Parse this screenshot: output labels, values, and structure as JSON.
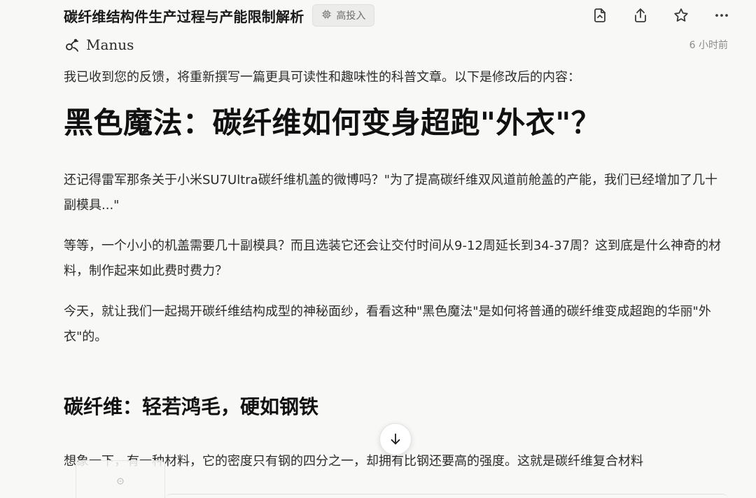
{
  "header": {
    "title": "碳纤维结构件生产过程与产能限制解析",
    "badge_label": "高投入",
    "badge_icon": "chip-icon",
    "toolbar_icons": [
      "file-export-icon",
      "share-icon",
      "star-icon",
      "more-icon"
    ]
  },
  "author": {
    "name": "Manus",
    "icon": "manus-logo",
    "timestamp": "6 小时前"
  },
  "article": {
    "intro": "我已收到您的反馈，将重新撰写一篇更具可读性和趣味性的科普文章。以下是修改后的内容：",
    "h1": "黑色魔法：碳纤维如何变身超跑\"外衣\"？",
    "p1": "还记得雷军那条关于小米SU7Ultra碳纤维机盖的微博吗？\"为了提高碳纤维双风道前舱盖的产能，我们已经增加了几十副模具...\"",
    "p2": "等等，一个小小的机盖需要几十副模具？而且选装它还会让交付时间从9-12周延长到34-37周？这到底是什么神奇的材料，制作起来如此费时费力？",
    "p3": "今天，就让我们一起揭开碳纤维结构成型的神秘面纱，看看这种\"黑色魔法\"是如何将普通的碳纤维变成超跑的华丽\"外衣\"的。",
    "h2": "碳纤维：轻若鸿毛，硬如钢铁",
    "p4": "想象一下，有一种材料，它的密度只有钢的四分之一，却拥有比钢还要高的强度。这就是碳纤维复合材料"
  },
  "scroll_button_icon": "arrow-down-icon"
}
